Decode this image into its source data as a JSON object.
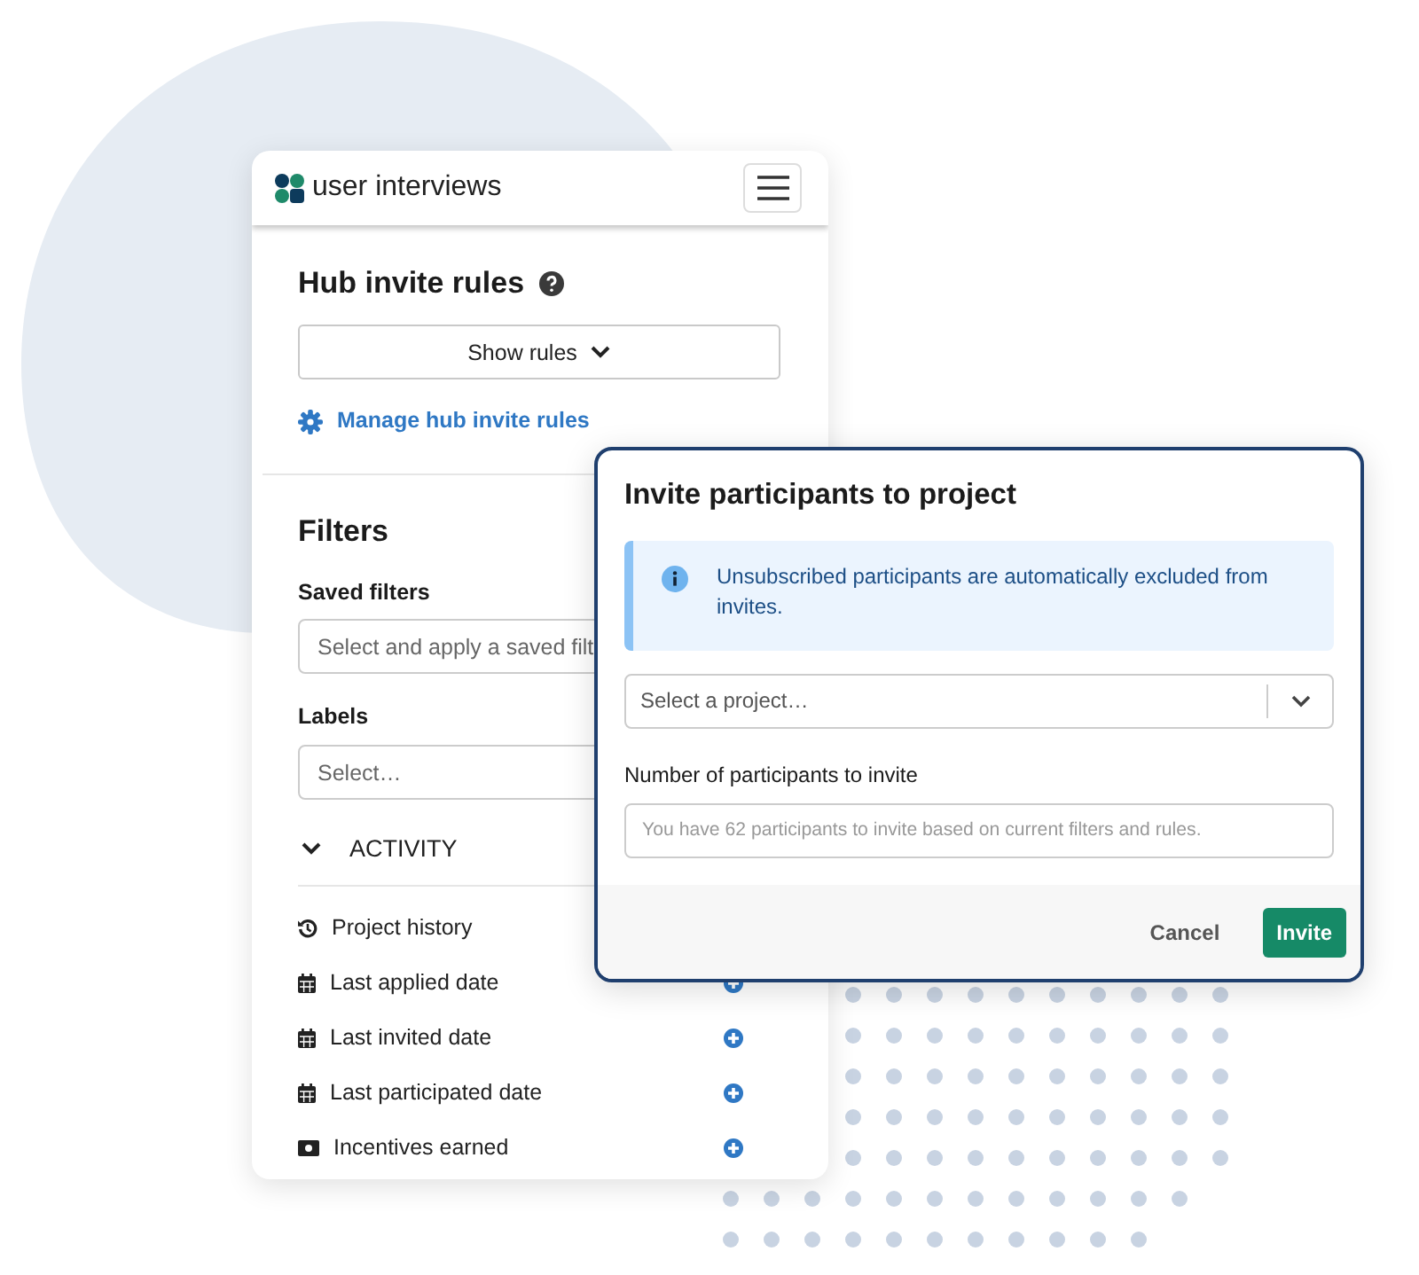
{
  "brand": {
    "name": "user interviews"
  },
  "hub_rules": {
    "title": "Hub invite rules",
    "toggle": "Show rules",
    "link": "Manage hub invite rules"
  },
  "filters": {
    "title": "Filters",
    "fields": [
      {
        "label": "Saved filters",
        "placeholder": "Select and apply a saved filt"
      },
      {
        "label": "Labels",
        "placeholder": "Select…"
      }
    ],
    "section": {
      "title": "ACTIVITY",
      "expanded": true,
      "items": [
        {
          "label": "Project history",
          "kind": "history"
        },
        {
          "label": "Last applied date",
          "kind": "calendar",
          "addable": true
        },
        {
          "label": "Last invited date",
          "kind": "calendar",
          "addable": true
        },
        {
          "label": "Last participated date",
          "kind": "calendar",
          "addable": true
        },
        {
          "label": "Incentives earned",
          "kind": "money",
          "addable": true
        }
      ]
    }
  },
  "modal": {
    "title": "Invite participants to project",
    "alert": "Unsubscribed participants are automatically excluded from invites.",
    "project_select": {
      "placeholder": "Select a project…"
    },
    "count_field": {
      "label": "Number of participants to invite",
      "placeholder": "You have 62 participants to invite based on current filters and rules."
    },
    "buttons": [
      {
        "label": "Cancel",
        "kind": "secondary"
      },
      {
        "label": "Invite",
        "kind": "primary"
      }
    ]
  }
}
